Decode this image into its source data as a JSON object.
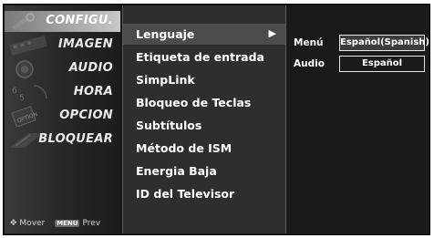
{
  "sidebar": {
    "items": [
      {
        "label": "CONFIGU.",
        "active": true
      },
      {
        "label": "IMAGEN",
        "active": false
      },
      {
        "label": "AUDIO",
        "active": false
      },
      {
        "label": "HORA",
        "active": false
      },
      {
        "label": "OPCION",
        "active": false
      },
      {
        "label": "BLOQUEAR",
        "active": false
      }
    ],
    "help": {
      "move_label": "Mover",
      "prev_key": "MENU",
      "prev_label": "Prev"
    }
  },
  "menu": {
    "items": [
      {
        "label": "Lenguaje",
        "active": true,
        "arrow": "▶"
      },
      {
        "label": "Etiqueta de entrada",
        "active": false
      },
      {
        "label": "SimpLink",
        "active": false
      },
      {
        "label": "Bloqueo de Teclas",
        "active": false
      },
      {
        "label": "Subtítulos",
        "active": false
      },
      {
        "label": "Método de ISM",
        "active": false
      },
      {
        "label": "Energia Baja",
        "active": false
      },
      {
        "label": "ID del Televisor",
        "active": false
      }
    ]
  },
  "panel": {
    "rows": [
      {
        "label": "Menú",
        "value": "Español(Spanish)",
        "selected": true
      },
      {
        "label": "Audio",
        "value": "Español",
        "selected": false
      }
    ]
  },
  "colors": {
    "osd_bg": "#181818",
    "active_highlight": "#4b4b4b"
  }
}
